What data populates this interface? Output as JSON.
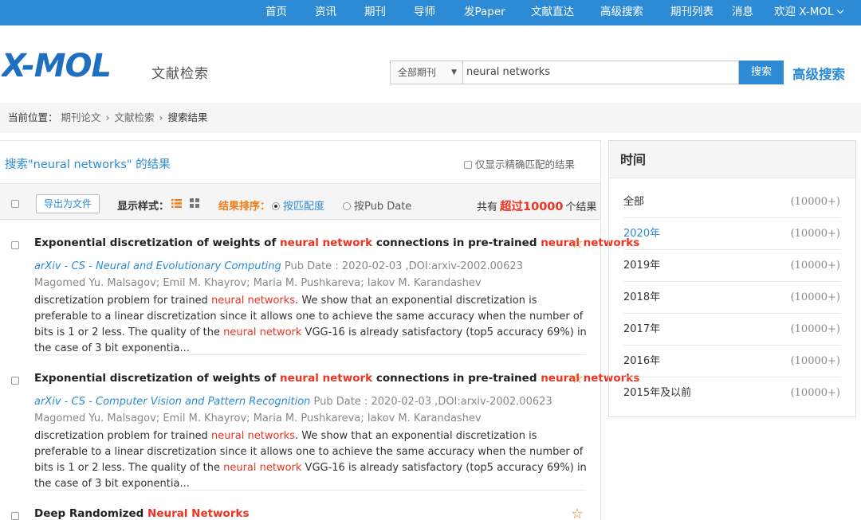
{
  "nav": {
    "items": [
      "首页",
      "资讯",
      "期刊",
      "导师",
      "发Paper",
      "文献直达",
      "高级搜索",
      "期刊列表",
      "消息"
    ],
    "user": "欢迎 X-MOL"
  },
  "header": {
    "logo_text": "X-MOL",
    "subtitle": "文献检索",
    "search_scope": "全部期刊",
    "search_query": "neural networks",
    "search_button": "搜索",
    "advanced_search": "高级搜索"
  },
  "breadcrumb": {
    "prefix": "当前位置：",
    "crumbs": [
      "期刊论文",
      "文献检索",
      "搜索结果"
    ],
    "separator": "›"
  },
  "results": {
    "heading": "搜索\"neural networks\" 的结果",
    "exact_match_label": "仅显示精确匹配的结果",
    "export_label": "导出为文件",
    "view_label": "显示样式：",
    "sort_label": "结果排序：",
    "sort_relevance": "按匹配度",
    "sort_date": "按Pub Date",
    "total_prefix": "共有",
    "total_count": "超过10000",
    "total_suffix": "个结果",
    "items": [
      {
        "title_parts": [
          "Exponential discretization of weights of ",
          "neural network",
          " connections in pre-trained ",
          "neural networks"
        ],
        "journal": "arXiv - CS - Neural and Evolutionary Computing",
        "meta": " Pub Date : 2020-02-03 ,DOI:arxiv-2002.00623",
        "authors": "Magomed Yu. Malsagov; Emil M. Khayrov; Maria M. Pushkareva; Iakov M. Karandashev",
        "abstract_parts": [
          "discretization problem for trained ",
          "neural networks",
          ". We show that an exponential discretization is preferable to a linear discretization since it allows one to achieve the same accuracy when the number of bits is 1 or 2 less. The quality of the ",
          "neural network",
          " VGG-16 is already satisfactory (top5 accuracy 69%) in the case of 3 bit exponentia..."
        ]
      },
      {
        "title_parts": [
          "Exponential discretization of weights of ",
          "neural network",
          " connections in pre-trained ",
          "neural networks"
        ],
        "journal": "arXiv - CS - Computer Vision and Pattern Recognition",
        "meta": " Pub Date : 2020-02-03 ,DOI:arxiv-2002.00623",
        "authors": "Magomed Yu. Malsagov; Emil M. Khayrov; Maria M. Pushkareva; Iakov M. Karandashev",
        "abstract_parts": [
          "discretization problem for trained ",
          "neural networks",
          ". We show that an exponential discretization is preferable to a linear discretization since it allows one to achieve the same accuracy when the number of bits is 1 or 2 less. The quality of the ",
          "neural network",
          " VGG-16 is already satisfactory (top5 accuracy 69%) in the case of 3 bit exponentia..."
        ]
      },
      {
        "title_parts": [
          "Deep Randomized ",
          "Neural Networks"
        ]
      }
    ]
  },
  "time_filter": {
    "heading": "时间",
    "rows": [
      {
        "label": "全部",
        "count": "(10000+)"
      },
      {
        "label": "2020年",
        "count": "(10000+)"
      },
      {
        "label": "2019年",
        "count": "(10000+)"
      },
      {
        "label": "2018年",
        "count": "(10000+)"
      },
      {
        "label": "2017年",
        "count": "(10000+)"
      },
      {
        "label": "2016年",
        "count": "(10000+)"
      },
      {
        "label": "2015年及以前",
        "count": "(10000+)"
      }
    ],
    "active_index": 1
  },
  "colors": {
    "brand_blue": "#2d8bd6",
    "highlight_red": "#e32",
    "accent_orange": "#f07d1a"
  }
}
